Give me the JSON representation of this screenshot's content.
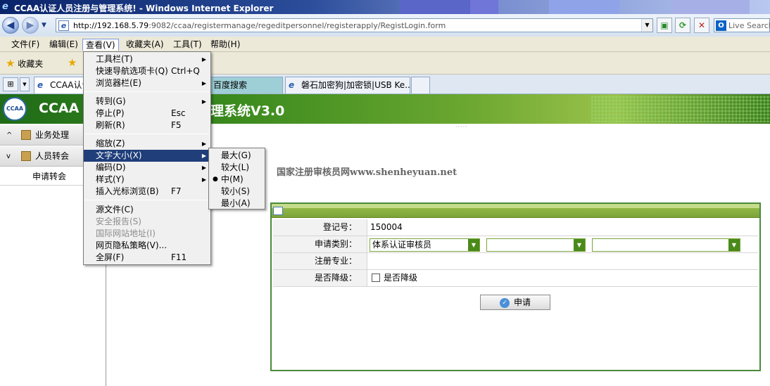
{
  "window": {
    "title": "CCAA认证人员注册与管理系统! - Windows Internet Explorer"
  },
  "address": {
    "url_host": "http://192.168.5.79",
    "url_rest": ":9082/ccaa/registermanage/regeditpersonnel/registerapply/RegistLogin.form",
    "search_placeholder": "Live Search"
  },
  "menubar": [
    {
      "label": "文件(F)"
    },
    {
      "label": "编辑(E)"
    },
    {
      "label": "查看(V)"
    },
    {
      "label": "收藏夹(A)"
    },
    {
      "label": "工具(T)"
    },
    {
      "label": "帮助(H)"
    }
  ],
  "favorites": {
    "label": "收藏夹"
  },
  "tabs": [
    {
      "label": "CCAA认证"
    },
    {
      "label": "百度搜索"
    },
    {
      "label": "磐石加密狗|加密锁|USB Ke..."
    }
  ],
  "banner": {
    "title_left": "CCAA",
    "title_right": "理系统V3.0",
    "logo_text": "CCAA"
  },
  "sidebar": {
    "sections": [
      {
        "label": "业务处理",
        "caret": "^"
      },
      {
        "label": "人员转会",
        "caret": "v"
      }
    ],
    "items": [
      {
        "label": "申请转会"
      }
    ]
  },
  "view_menu": [
    {
      "label": "工具栏(T)",
      "shortcut": "",
      "submenu": true,
      "disabled": false
    },
    {
      "label": "快速导航选项卡(Q)",
      "shortcut": "Ctrl+Q",
      "submenu": false,
      "disabled": false
    },
    {
      "label": "浏览器栏(E)",
      "shortcut": "",
      "submenu": true,
      "disabled": false
    },
    {
      "label": "转到(G)",
      "shortcut": "",
      "submenu": true,
      "disabled": false
    },
    {
      "label": "停止(P)",
      "shortcut": "Esc",
      "submenu": false,
      "disabled": false
    },
    {
      "label": "刷新(R)",
      "shortcut": "F5",
      "submenu": false,
      "disabled": false
    },
    {
      "label": "缩放(Z)",
      "shortcut": "",
      "submenu": true,
      "disabled": false
    },
    {
      "label": "文字大小(X)",
      "shortcut": "",
      "submenu": true,
      "disabled": false,
      "highlighted": true
    },
    {
      "label": "编码(D)",
      "shortcut": "",
      "submenu": true,
      "disabled": false
    },
    {
      "label": "样式(Y)",
      "shortcut": "",
      "submenu": true,
      "disabled": false
    },
    {
      "label": "插入光标浏览(B)",
      "shortcut": "F7",
      "submenu": false,
      "disabled": false
    },
    {
      "label": "源文件(C)",
      "shortcut": "",
      "submenu": false,
      "disabled": false
    },
    {
      "label": "安全报告(S)",
      "shortcut": "",
      "submenu": false,
      "disabled": true
    },
    {
      "label": "国际网站地址(I)",
      "shortcut": "",
      "submenu": false,
      "disabled": true
    },
    {
      "label": "网页隐私策略(V)...",
      "shortcut": "",
      "submenu": false,
      "disabled": false
    },
    {
      "label": "全屏(F)",
      "shortcut": "F11",
      "submenu": false,
      "disabled": false
    }
  ],
  "text_size_menu": [
    {
      "label": "最大(G)",
      "selected": false
    },
    {
      "label": "较大(L)",
      "selected": false
    },
    {
      "label": "中(M)",
      "selected": true
    },
    {
      "label": "较小(S)",
      "selected": false
    },
    {
      "label": "最小(A)",
      "selected": false
    }
  ],
  "watermark": "国家注册审核员网www.shenheyuan.net",
  "form": {
    "registration_no_label": "登记号：",
    "registration_no_value": "150004",
    "apply_type_label": "申请类别：",
    "apply_type_value": "体系认证审核员",
    "apply_type_2_value": "",
    "apply_type_3_value": "",
    "specialty_label": "注册专业：",
    "specialty_value": "",
    "downgrade_label": "是否降级：",
    "downgrade_checkbox_label": "是否降级",
    "downgrade_checked": false,
    "submit_label": "申请"
  },
  "colors": {
    "banner_green": "#3a8a1e",
    "menu_highlight": "#1f3e7a",
    "form_border": "#4a8a3a",
    "select_arrow": "#4a8a1a"
  }
}
